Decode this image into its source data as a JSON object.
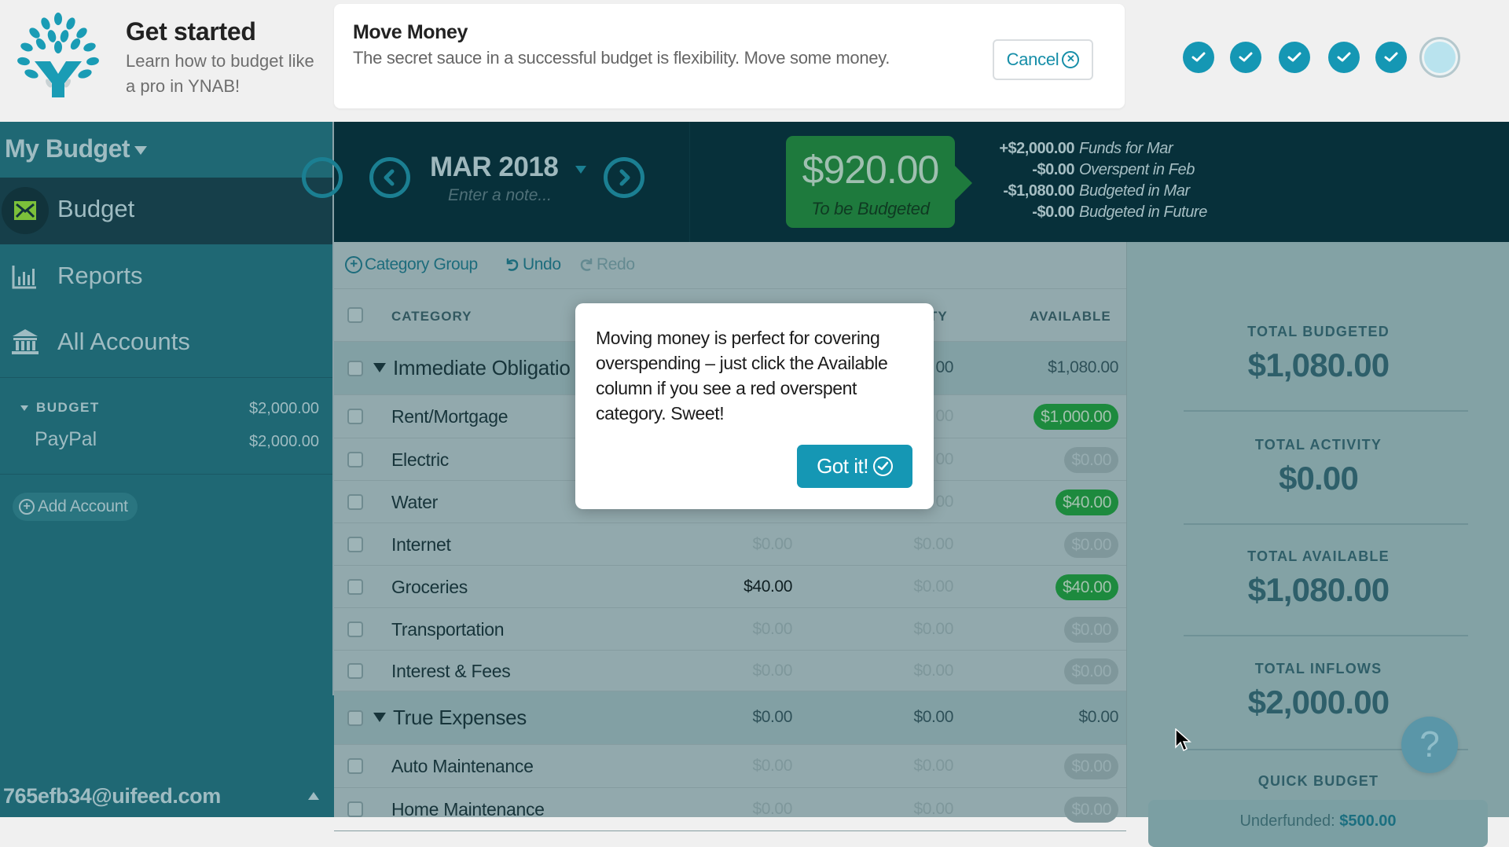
{
  "onboarding": {
    "title": "Get started",
    "subtitle": "Learn how to budget like a pro in YNAB!",
    "task": {
      "title": "Move Money",
      "description": "The secret sauce in a successful budget is flexibility. Move some money.",
      "cancel_label": "Cancel"
    },
    "steps": [
      {
        "status": "complete"
      },
      {
        "status": "complete"
      },
      {
        "status": "complete"
      },
      {
        "status": "complete"
      },
      {
        "status": "complete"
      },
      {
        "status": "current"
      }
    ],
    "steps_completed": 5,
    "steps_total": 6
  },
  "sidebar": {
    "budget_name": "My Budget",
    "nav": [
      {
        "label": "Budget",
        "icon": "envelope-icon",
        "active": true
      },
      {
        "label": "Reports",
        "icon": "bar-chart-icon",
        "active": false
      },
      {
        "label": "All Accounts",
        "icon": "bank-icon",
        "active": false
      }
    ],
    "account_group": {
      "label": "BUDGET",
      "total": "$2,000.00",
      "accounts": [
        {
          "name": "PayPal",
          "balance": "$2,000.00"
        }
      ]
    },
    "add_account_label": "Add Account",
    "user_email": "765efb34@uifeed.com"
  },
  "header": {
    "month": "MAR 2018",
    "note_placeholder": "Enter a note...",
    "to_be_budgeted": {
      "amount": "$920.00",
      "label": "To be Budgeted"
    },
    "breakdown": [
      {
        "amount": "+$2,000.00",
        "label": "Funds for Mar"
      },
      {
        "amount": "-$0.00",
        "label": "Overspent in Feb"
      },
      {
        "amount": "-$1,080.00",
        "label": "Budgeted in Mar"
      },
      {
        "amount": "-$0.00",
        "label": "Budgeted in Future"
      }
    ]
  },
  "toolbar": {
    "category_group_label": "Category Group",
    "undo_label": "Undo",
    "redo_label": "Redo"
  },
  "table": {
    "columns": {
      "category": "CATEGORY",
      "activity_partial": "TY",
      "available": "AVAILABLE"
    },
    "rows": [
      {
        "type": "group",
        "name": "Immediate Obligatio",
        "budgeted": "",
        "activity": "00",
        "available": "$1,080.00"
      },
      {
        "type": "item",
        "name": "Rent/Mortgage",
        "budgeted": "",
        "activity": "00",
        "available": "$1,000.00",
        "available_style": "green"
      },
      {
        "type": "item",
        "name": "Electric",
        "budgeted": "",
        "activity": "00",
        "available": "$0.00",
        "available_style": "grey"
      },
      {
        "type": "item",
        "name": "Water",
        "budgeted": "",
        "activity": "00",
        "available": "$40.00",
        "available_style": "green"
      },
      {
        "type": "item",
        "name": "Internet",
        "budgeted": "$0.00",
        "activity": "$0.00",
        "available": "$0.00",
        "available_style": "grey"
      },
      {
        "type": "item",
        "name": "Groceries",
        "budgeted": "$40.00",
        "activity": "$0.00",
        "available": "$40.00",
        "available_style": "green",
        "budgeted_highlight": true
      },
      {
        "type": "item",
        "name": "Transportation",
        "budgeted": "$0.00",
        "activity": "$0.00",
        "available": "$0.00",
        "available_style": "grey"
      },
      {
        "type": "item",
        "name": "Interest & Fees",
        "budgeted": "$0.00",
        "activity": "$0.00",
        "available": "$0.00",
        "available_style": "grey"
      },
      {
        "type": "group",
        "name": "True Expenses",
        "budgeted": "$0.00",
        "activity": "$0.00",
        "available": "$0.00"
      },
      {
        "type": "item",
        "name": "Auto Maintenance",
        "budgeted": "$0.00",
        "activity": "$0.00",
        "available": "$0.00",
        "available_style": "grey"
      },
      {
        "type": "item",
        "name": "Home Maintenance",
        "budgeted": "$0.00",
        "activity": "$0.00",
        "available": "$0.00",
        "available_style": "grey"
      }
    ]
  },
  "inspector": {
    "totals": [
      {
        "label": "TOTAL BUDGETED",
        "value": "$1,080.00"
      },
      {
        "label": "TOTAL ACTIVITY",
        "value": "$0.00"
      },
      {
        "label": "TOTAL AVAILABLE",
        "value": "$1,080.00"
      },
      {
        "label": "TOTAL INFLOWS",
        "value": "$2,000.00"
      }
    ],
    "quick_budget_label": "QUICK BUDGET",
    "quick_budget_button": {
      "prefix": "Underfunded:",
      "amount": "$500.00"
    }
  },
  "popup": {
    "text": "Moving money is perfect for covering overspending – just click the Available column if you see a red overspent category. Sweet!",
    "button_label": "Got it!"
  },
  "help_label": "?",
  "colors": {
    "brand": "#1597b4",
    "positive": "#1d8a3e",
    "header_dark": "#07303a",
    "sidebar": "#1f6874"
  }
}
